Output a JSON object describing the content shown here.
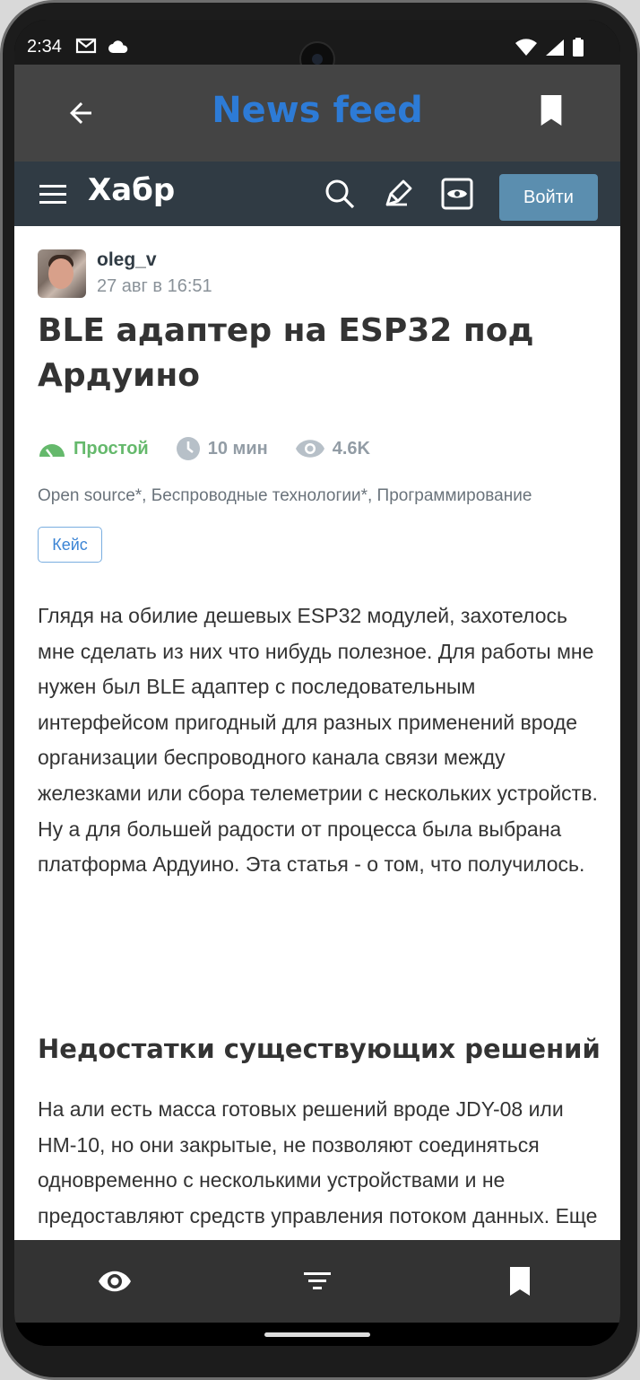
{
  "status_bar": {
    "time": "2:34",
    "left_icons": [
      "gmail-icon",
      "cloud-icon"
    ],
    "right_icons": [
      "wifi-icon",
      "signal-icon",
      "battery-icon"
    ]
  },
  "app_bar": {
    "title": "News feed",
    "title_color": "#2d7bd6",
    "back_icon": "arrow-back-icon",
    "bookmark_icon": "bookmark-icon"
  },
  "habr_header": {
    "logo": "Хабр",
    "icons": [
      "search-icon",
      "pen-icon",
      "eye-icon"
    ],
    "login_label": "Войти",
    "background": "#303b44",
    "login_color": "#5b8eaf"
  },
  "article": {
    "author": "oleg_v",
    "date": "27 авг в 16:51",
    "title": "BLE адаптер на ESP32 под Ардуино",
    "complexity": "Простой",
    "complexity_color": "#65b96c",
    "reading_time": "10 мин",
    "views": "4.6K",
    "hubs": "Open source*, Беспроводные технологии*, Программирование",
    "badge": "Кейс",
    "paragraph_1": "Глядя на обилие дешевых ESP32 модулей, захотелось мне сделать из них что нибудь полезное. Для работы мне нужен был BLE адаптер с последовательным интерфейсом пригодный для разных применений вроде организации беспроводного канала связи между железками или сбора телеметрии с нескольких устройств. Ну а для большей радости от процесса была выбрана платформа Ардуино. Эта статья - о том, что получилось.",
    "section_heading": "Недостатки существующих решений",
    "paragraph_2": "На али есть масса готовых решений вроде JDY-08 или HM-10, но они закрытые, не позволяют соединяться одновременно с несколькими устройствами и не предоставляют средств управления потоком данных. Еще об одном"
  },
  "bottom_nav": {
    "items": [
      "eye-icon",
      "filter-icon",
      "bookmark-icon"
    ]
  }
}
